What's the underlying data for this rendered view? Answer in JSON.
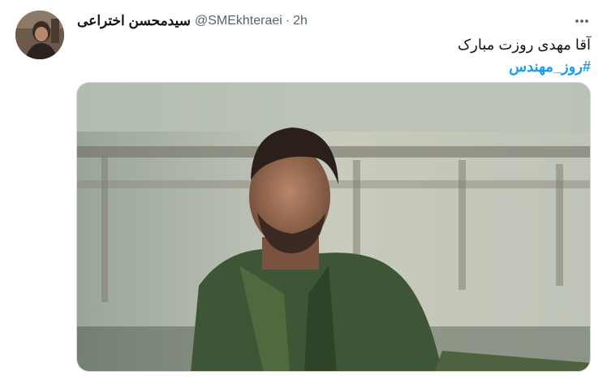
{
  "tweet": {
    "author": {
      "display_name": "سیدمحسن اختراعی",
      "handle": "@SMEkhteraei",
      "avatar_icon": "person-avatar-photo"
    },
    "separator": "·",
    "timestamp": "2h",
    "more_icon": "more-horizontal-icon",
    "text_line": "آقا مهدی روزت مبارک",
    "hashtag": "#روز_مهندس",
    "media": {
      "description_icon": "photo-man-in-olive-shirt"
    },
    "colors": {
      "hashtag": "#1d9bf0",
      "secondary_text": "#536471",
      "primary_text": "#0f1419"
    }
  }
}
